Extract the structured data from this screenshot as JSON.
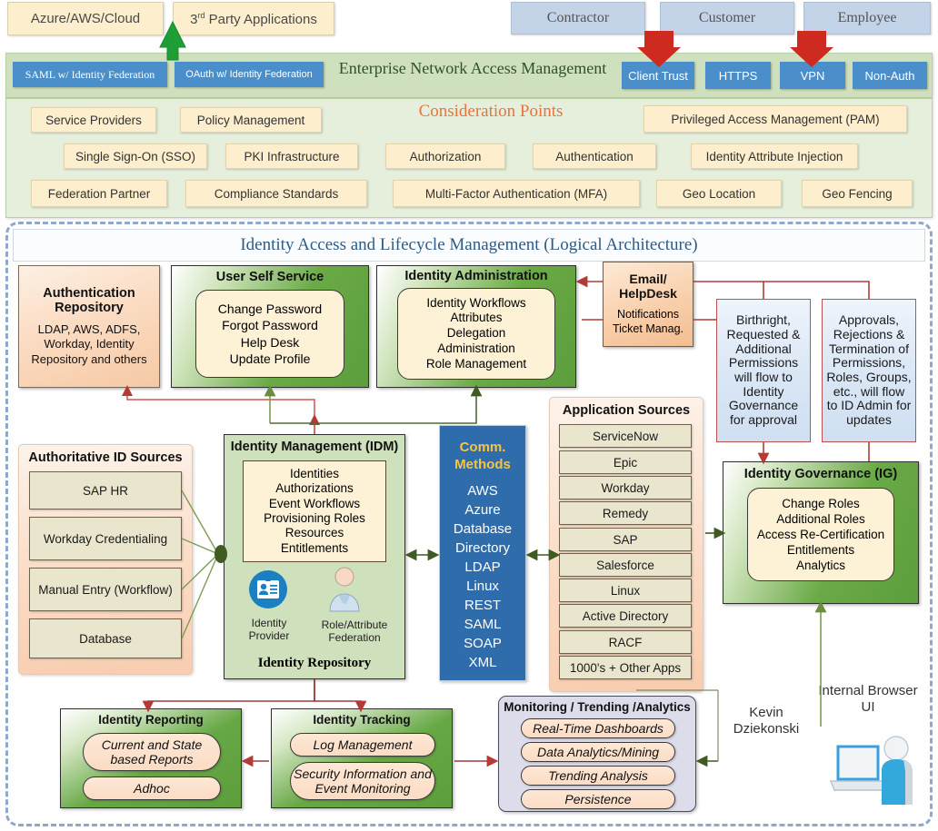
{
  "top_tags": [
    {
      "label": "Azure/AWS/Cloud"
    },
    {
      "label": "3rd Party Applications",
      "sup": "rd",
      "pre": "3",
      "post": " Party Applications"
    }
  ],
  "personas": [
    "Contractor",
    "Customer",
    "Employee"
  ],
  "enterprise_band": {
    "title": "Enterprise Network Access Management",
    "left_chips": [
      "SAML w/ Identity Federation",
      "OAuth w/ Identity Federation"
    ],
    "right_chips": [
      "Client Trust",
      "HTTPS",
      "VPN",
      "Non-Auth"
    ]
  },
  "consideration": {
    "title": "Consideration Points",
    "row1": [
      "Service Providers",
      "Policy Management",
      "Privileged Access Management (PAM)"
    ],
    "row2": [
      "Single Sign-On (SSO)",
      "PKI Infrastructure",
      "Authorization",
      "Authentication",
      "Identity Attribute Injection"
    ],
    "row3": [
      "Federation Partner",
      "Compliance Standards",
      "Multi-Factor Authentication (MFA)",
      "Geo Location",
      "Geo Fencing"
    ]
  },
  "architecture": {
    "title": "Identity Access  and Lifecycle Management (Logical Architecture)"
  },
  "auth_repository": {
    "title_line1": "Authentication",
    "title_line2": "Repository",
    "body": "LDAP, AWS, ADFS, Workday, Identity Repository and others"
  },
  "user_self_service": {
    "title": "User Self Service",
    "items": [
      "Change Password",
      "Forgot Password",
      "Help Desk",
      "Update Profile"
    ]
  },
  "identity_administration": {
    "title": "Identity Administration",
    "items": [
      "Identity Workflows",
      "Attributes",
      "Delegation",
      "Administration",
      "Role Management"
    ]
  },
  "email_helpdesk": {
    "title_line1": "Email/",
    "title_line2": "HelpDesk",
    "body_line1": "Notifications",
    "body_line2": "Ticket Manag."
  },
  "note_birthright": "Birthright, Requested & Additional Permissions will flow to Identity Governance for approval",
  "note_approvals": "Approvals, Rejections & Termination of Permissions, Roles, Groups, etc., will flow to ID Admin for updates",
  "authoritative_sources": {
    "title": "Authoritative ID Sources",
    "items": [
      "SAP HR",
      "Workday Credentialing",
      "Manual Entry (Workflow)",
      "Database"
    ]
  },
  "idm": {
    "title": "Identity Management (IDM)",
    "items": [
      "Identities",
      "Authorizations",
      "Event Workflows",
      "Provisioning Roles",
      "Resources",
      "Entitlements"
    ],
    "icon1_label_line1": "Identity",
    "icon1_label_line2": "Provider",
    "icon2_label_line1": "Role/Attribute",
    "icon2_label_line2": "Federation",
    "footer": "Identity Repository"
  },
  "comm_methods": {
    "header_line1": "Comm.",
    "header_line2": "Methods",
    "items": [
      "AWS",
      "Azure",
      "Database",
      "Directory",
      "LDAP",
      "Linux",
      "REST",
      "SAML",
      "SOAP",
      "XML"
    ]
  },
  "application_sources": {
    "title": "Application Sources",
    "items": [
      "ServiceNow",
      "Epic",
      "Workday",
      "Remedy",
      "SAP",
      "Salesforce",
      "Linux",
      "Active Directory",
      "RACF",
      "1000's + Other Apps"
    ]
  },
  "identity_governance": {
    "title": "Identity Governance (IG)",
    "items": [
      "Change Roles",
      "Additional  Roles",
      "Access Re-Certification",
      "Entitlements",
      "Analytics"
    ]
  },
  "identity_reporting": {
    "title": "Identity Reporting",
    "pill1": "Current and State based Reports",
    "pill2": "Adhoc"
  },
  "identity_tracking": {
    "title": "Identity Tracking",
    "pill1": "Log Management",
    "pill2": "Security Information and Event Monitoring"
  },
  "monitoring": {
    "title": "Monitoring / Trending /Analytics",
    "items": [
      "Real-Time Dashboards",
      "Data Analytics/Mining",
      "Trending Analysis",
      "Persistence"
    ]
  },
  "author_credit": "Kevin Dziekonski",
  "browser_ui_label": "Internal Browser UI",
  "colors": {
    "band_green": "#cfe0bf",
    "chip_blue": "#4a8fc9",
    "accent_orange": "#e8743b",
    "arch_blue": "#2d5b86",
    "red_arrow": "#c0504d",
    "green_arrow": "#6b8e3e",
    "comm_blue": "#2f6cab",
    "comm_header_gold": "#f5c542"
  }
}
